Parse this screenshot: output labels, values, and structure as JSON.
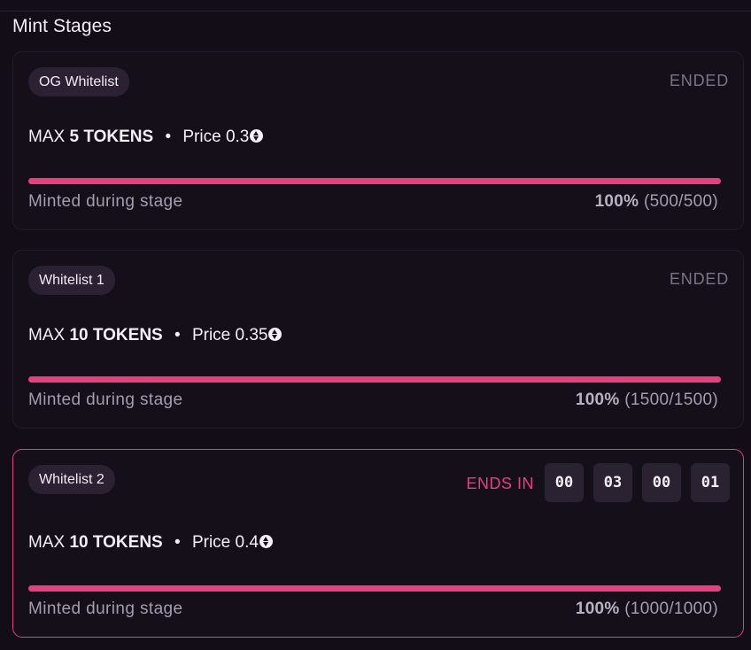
{
  "section_title": "Mint Stages",
  "colors": {
    "accent": "#e6407f",
    "background": "#120d17",
    "card": "#140f19",
    "muted_text": "#a69bb0"
  },
  "icons": {
    "currency": "eth-icon"
  },
  "stages": [
    {
      "name": "OG Whitelist",
      "status": "ENDED",
      "max_prefix": "MAX",
      "max_tokens": "5 TOKENS",
      "separator": "•",
      "price_label": "Price 0.3",
      "minted_label": "Minted during stage",
      "minted_percent": "100%",
      "minted_count": "(500/500)",
      "progress": 1.0
    },
    {
      "name": "Whitelist 1",
      "status": "ENDED",
      "max_prefix": "MAX",
      "max_tokens": "10 TOKENS",
      "separator": "•",
      "price_label": "Price 0.35",
      "minted_label": "Minted during stage",
      "minted_percent": "100%",
      "minted_count": "(1500/1500)",
      "progress": 1.0
    },
    {
      "name": "Whitelist 2",
      "status": "ENDS IN",
      "countdown": [
        "00",
        "03",
        "00",
        "01"
      ],
      "max_prefix": "MAX",
      "max_tokens": "10 TOKENS",
      "separator": "•",
      "price_label": "Price 0.4",
      "minted_label": "Minted during stage",
      "minted_percent": "100%",
      "minted_count": "(1000/1000)",
      "progress": 1.0
    }
  ]
}
